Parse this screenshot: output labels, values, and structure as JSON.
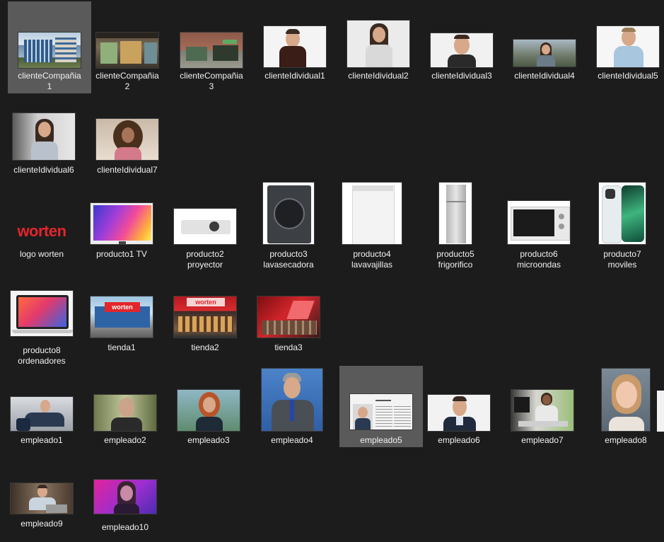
{
  "files": [
    {
      "id": "clienteCompania1",
      "label": "clienteCompañia\n1",
      "selected": true,
      "icon": "company-photo-icon"
    },
    {
      "id": "clienteCompania2",
      "label": "clienteCompañia\n2",
      "icon": "shop-front-photo-icon"
    },
    {
      "id": "clienteCompania3",
      "label": "clienteCompañia\n3",
      "icon": "shop-front-photo-icon"
    },
    {
      "id": "clienteIdividual1",
      "label": "clienteIdividual1",
      "icon": "person-photo-icon"
    },
    {
      "id": "clienteIdividual2",
      "label": "clienteIdividual2",
      "icon": "person-photo-icon"
    },
    {
      "id": "clienteIdividual3",
      "label": "clienteIdividual3",
      "icon": "person-photo-icon"
    },
    {
      "id": "clienteIdividual4",
      "label": "clienteIdividual4",
      "icon": "person-photo-icon"
    },
    {
      "id": "clienteIdividual5",
      "label": "clienteIdividual5",
      "icon": "person-photo-icon"
    },
    {
      "id": "clienteIdividual6",
      "label": "clienteIdividual6",
      "icon": "person-photo-icon"
    },
    {
      "id": "clienteIdividual7",
      "label": "clienteIdividual7",
      "icon": "person-photo-icon"
    },
    {
      "id": "logoWorten",
      "label": "logo worten",
      "icon": "worten-logo-icon",
      "logo_text": "worten"
    },
    {
      "id": "producto1",
      "label": "producto1 TV",
      "icon": "tv-photo-icon"
    },
    {
      "id": "producto2",
      "label": "producto2\nproyector",
      "icon": "projector-photo-icon"
    },
    {
      "id": "producto3",
      "label": "producto3\nlavasecadora",
      "icon": "washer-photo-icon"
    },
    {
      "id": "producto4",
      "label": "producto4\nlavavajillas",
      "icon": "dishwasher-photo-icon"
    },
    {
      "id": "producto5",
      "label": "producto5\nfrigorifico",
      "icon": "fridge-photo-icon"
    },
    {
      "id": "producto6",
      "label": "producto6\nmicroondas",
      "icon": "microwave-photo-icon"
    },
    {
      "id": "producto7",
      "label": "producto7\nmoviles",
      "icon": "phone-photo-icon"
    },
    {
      "id": "producto8",
      "label": "producto8\nordenadores",
      "icon": "laptop-photo-icon"
    },
    {
      "id": "tienda1",
      "label": "tienda1",
      "icon": "store-photo-icon",
      "sign_text": "worten"
    },
    {
      "id": "tienda2",
      "label": "tienda2",
      "icon": "store-photo-icon",
      "sign_text": "worten"
    },
    {
      "id": "tienda3",
      "label": "tienda3",
      "icon": "store-photo-icon"
    },
    {
      "id": "empleado1",
      "label": "empleado1",
      "icon": "person-photo-icon"
    },
    {
      "id": "empleado2",
      "label": "empleado2",
      "icon": "person-photo-icon"
    },
    {
      "id": "empleado3",
      "label": "empleado3",
      "icon": "person-photo-icon"
    },
    {
      "id": "empleado4",
      "label": "empleado4",
      "icon": "person-photo-icon"
    },
    {
      "id": "empleado5",
      "label": "empleado5",
      "selected": true,
      "icon": "document-photo-icon"
    },
    {
      "id": "empleado6",
      "label": "empleado6",
      "icon": "person-photo-icon"
    },
    {
      "id": "empleado7",
      "label": "empleado7",
      "icon": "person-photo-icon"
    },
    {
      "id": "empleado8",
      "label": "empleado8",
      "icon": "person-photo-icon"
    },
    {
      "id": "empleado9",
      "label": "empleado9",
      "icon": "person-photo-icon"
    },
    {
      "id": "empleado10",
      "label": "empleado10",
      "icon": "person-photo-icon"
    }
  ],
  "colors": {
    "background": "#1c1c1c",
    "selection": "#5a5a5a",
    "worten_red": "#e3262c"
  }
}
